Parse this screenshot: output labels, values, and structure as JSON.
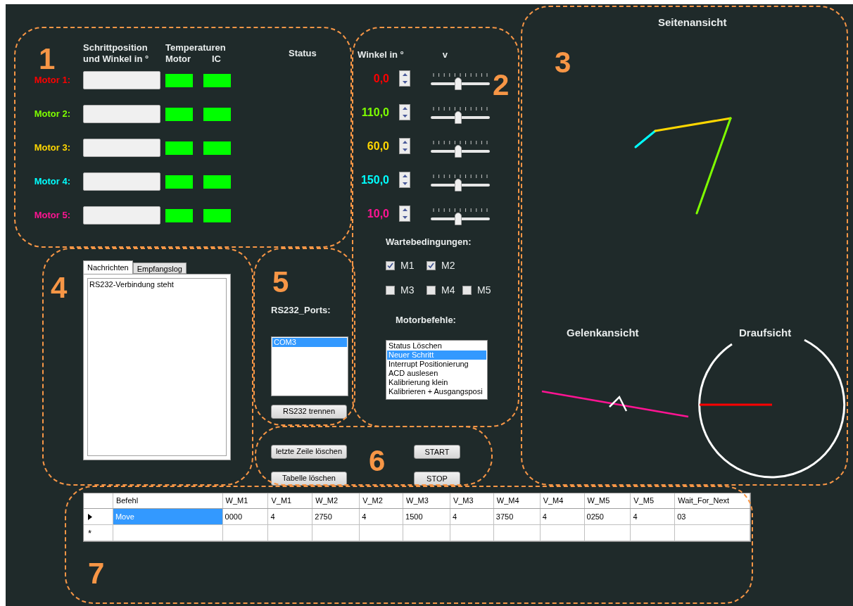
{
  "status_panel": {
    "number": "1",
    "position_heading": [
      "Schrittposition",
      "und Winkel in °"
    ],
    "temperature_heading": "Temperaturen",
    "motor_heading": "Motor",
    "ic_heading": "IC",
    "status_heading": "Status"
  },
  "motors": [
    {
      "label": "Motor 1:",
      "color": "#ff0000",
      "motor_temp_ok": true,
      "ic_temp_ok": true
    },
    {
      "label": "Motor 2:",
      "color": "#7fff00",
      "motor_temp_ok": true,
      "ic_temp_ok": true
    },
    {
      "label": "Motor 3:",
      "color": "#ffd700",
      "motor_temp_ok": true,
      "ic_temp_ok": true
    },
    {
      "label": "Motor 4:",
      "color": "#00ffff",
      "motor_temp_ok": true,
      "ic_temp_ok": true
    },
    {
      "label": "Motor 5:",
      "color": "#ff1493",
      "motor_temp_ok": true,
      "ic_temp_ok": true
    }
  ],
  "angle_panel": {
    "number": "2",
    "angle_heading": "Winkel in °",
    "speed_heading": "v",
    "rows": [
      {
        "value": "0,0",
        "color": "#ff0000",
        "level": 0.45
      },
      {
        "value": "110,0",
        "color": "#7fff00",
        "level": 0.45
      },
      {
        "value": "60,0",
        "color": "#ffd700",
        "level": 0.45
      },
      {
        "value": "150,0",
        "color": "#00ffff",
        "level": 0.45
      },
      {
        "value": "10,0",
        "color": "#ff1493",
        "level": 0.45
      }
    ],
    "wait_heading": "Wartebedingungen:",
    "wait_conditions": [
      {
        "label": "M1",
        "checked": true
      },
      {
        "label": "M2",
        "checked": true
      },
      {
        "label": "M3",
        "checked": false
      },
      {
        "label": "M4",
        "checked": false
      },
      {
        "label": "M5",
        "checked": false
      }
    ],
    "commands_heading": "Motorbefehle:",
    "commands": [
      {
        "label": "Status Löschen",
        "selected": false
      },
      {
        "label": "Neuer Schritt",
        "selected": true
      },
      {
        "label": "Interrupt Positionierung",
        "selected": false
      },
      {
        "label": "ACD auslesen",
        "selected": false
      },
      {
        "label": "Kalibrierung klein",
        "selected": false
      },
      {
        "label": "Kalibrieren + Ausgangsposi",
        "selected": false
      }
    ]
  },
  "view_panel": {
    "number": "3",
    "side_title": "Seitenansicht",
    "joint_title": "Gelenkansicht",
    "top_title": "Draufsicht"
  },
  "messages_panel": {
    "number": "4",
    "tabs": [
      {
        "label": "Nachrichten",
        "selected": true
      },
      {
        "label": "Empfangslog",
        "selected": false
      }
    ],
    "messages": [
      "RS232-Verbindung steht"
    ]
  },
  "port_panel": {
    "number": "5",
    "heading": "RS232_Ports:",
    "ports": [
      {
        "label": "COM3",
        "selected": true
      }
    ],
    "disconnect_button": "RS232 trennen"
  },
  "command_panel": {
    "number": "6",
    "buttons": [
      "letzte Zeile löschen",
      "Tabelle löschen"
    ],
    "start_button": "START",
    "stop_button": "STOP"
  },
  "table": {
    "number": "7",
    "columns": [
      "Befehl",
      "W_M1",
      "V_M1",
      "W_M2",
      "V_M2",
      "W_M3",
      "V_M3",
      "W_M4",
      "V_M4",
      "W_M5",
      "V_M5",
      "Wait_For_Next"
    ],
    "rows": [
      {
        "kind": "data",
        "selected": true,
        "cells": [
          "Move",
          "0000",
          "4",
          "2750",
          "4",
          "1500",
          "4",
          "3750",
          "4",
          "0250",
          "4",
          "03"
        ]
      },
      {
        "kind": "new",
        "selected": false,
        "marker": "*"
      }
    ]
  }
}
